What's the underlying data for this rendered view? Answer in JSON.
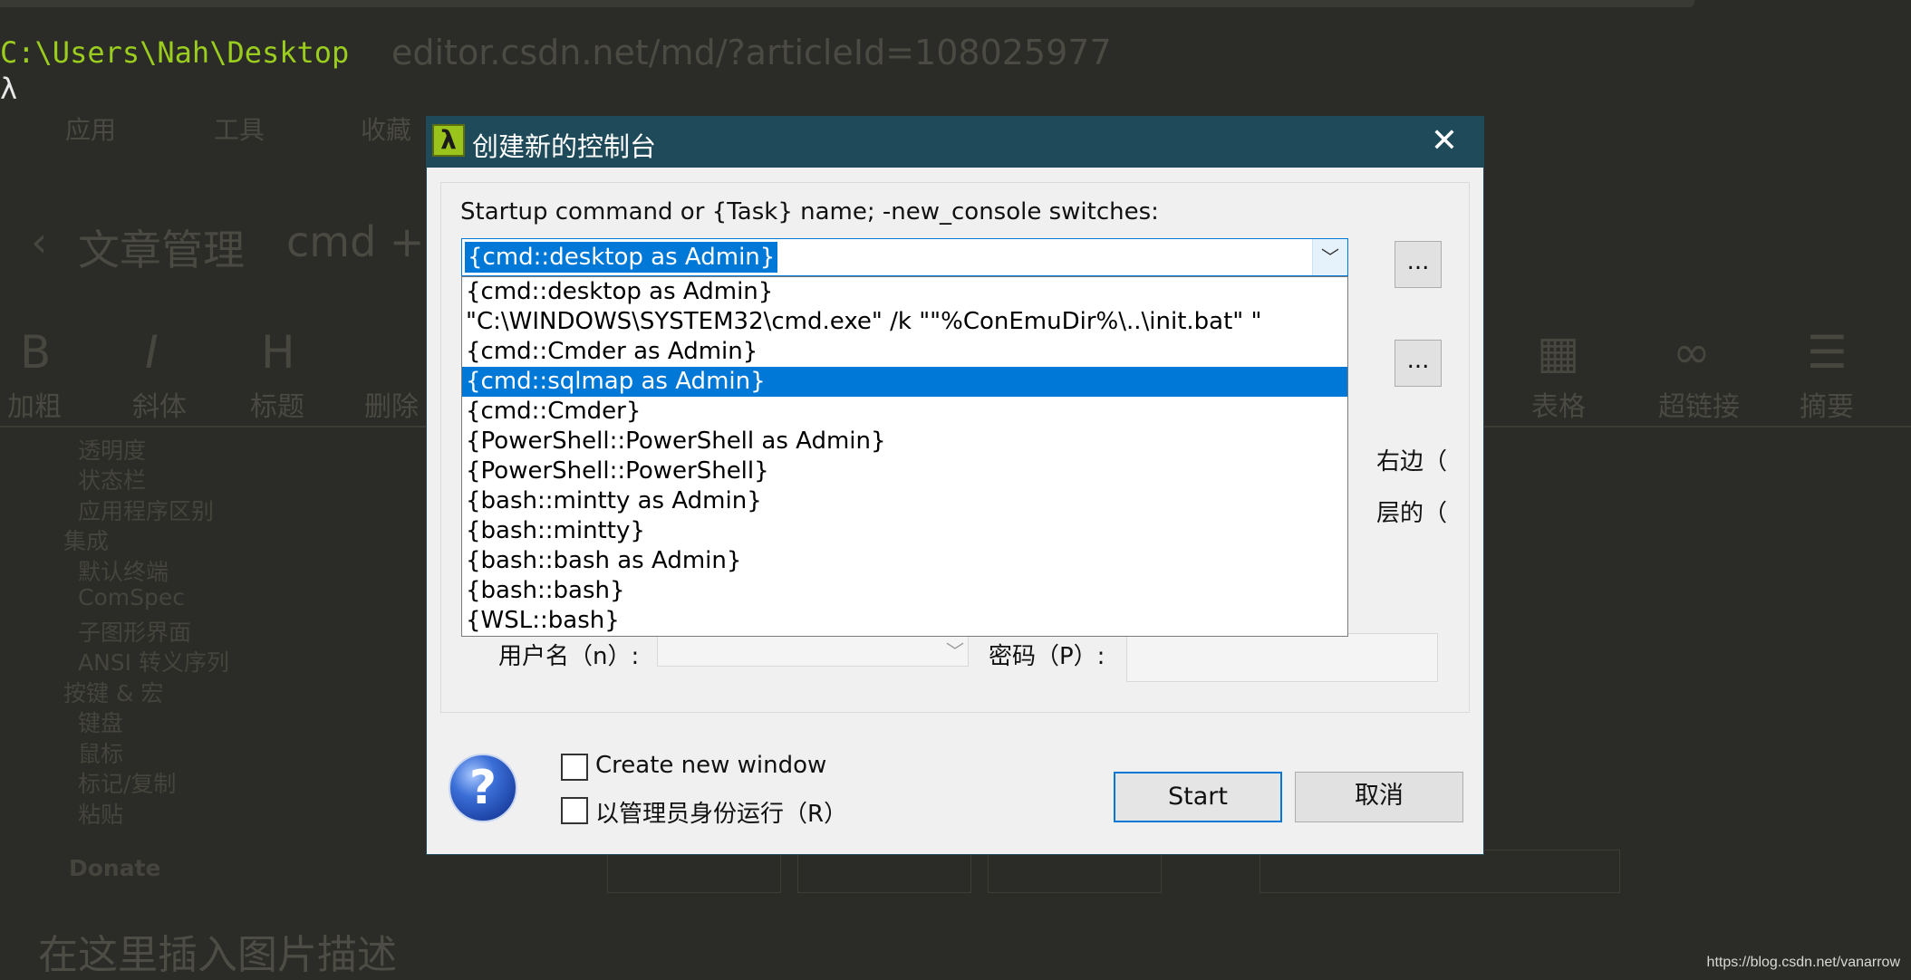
{
  "background": {
    "url_text": "editor.csdn.net/md/?articleId=108025977",
    "bookmarks": [
      "应用",
      "工具",
      "收藏"
    ],
    "article_crumb": "文章管理",
    "article_title_fragment": "cmd + c",
    "toolbar_labels": [
      "加粗",
      "斜体",
      "标题",
      "删除",
      "表格",
      "超链接",
      "摘要"
    ],
    "settings_list": [
      "透明度",
      "状态栏",
      "应用程序区别",
      "集成",
      "默认终端",
      "ComSpec",
      "子图形界面",
      "ANSI 转义序列",
      "按键 & 宏",
      "键盘",
      "鼠标",
      "标记/复制",
      "粘贴"
    ],
    "donate": "Donate",
    "caption": "在这里插入图片描述"
  },
  "terminal": {
    "path": "C:\\Users\\Nah\\Desktop",
    "prompt": "λ"
  },
  "dialog": {
    "icon_glyph": "λ",
    "title": "创建新的控制台",
    "close_glyph": "✕",
    "command_label": "Startup command or {Task} name; -new_console switches:",
    "combo_value": "{cmd::desktop as Admin}",
    "dots_label": "...",
    "dropdown_items": [
      "{cmd::desktop as Admin}",
      "\"C:\\WINDOWS\\SYSTEM32\\cmd.exe\"  /k \"\"%ConEmuDir%\\..\\init.bat\" \"",
      "{cmd::Cmder as Admin}",
      "{cmd::sqlmap as Admin}",
      "{cmd::Cmder}",
      "{PowerShell::PowerShell as Admin}",
      "{PowerShell::PowerShell}",
      "{bash::mintty as Admin}",
      "{bash::mintty}",
      "{bash::bash as Admin}",
      "{bash::bash}",
      "{WSL::bash}"
    ],
    "selected_index": 3,
    "partial_right_1": "右边（",
    "partial_right_2": "层的（",
    "username_label": "用户名（n）:",
    "password_label": "密码（P）:",
    "create_new_window": "Create new window",
    "run_as_admin": "以管理员身份运行（R）",
    "start_button": "Start",
    "cancel_button": "取消"
  },
  "watermark": "https://blog.csdn.net/vanarrow"
}
